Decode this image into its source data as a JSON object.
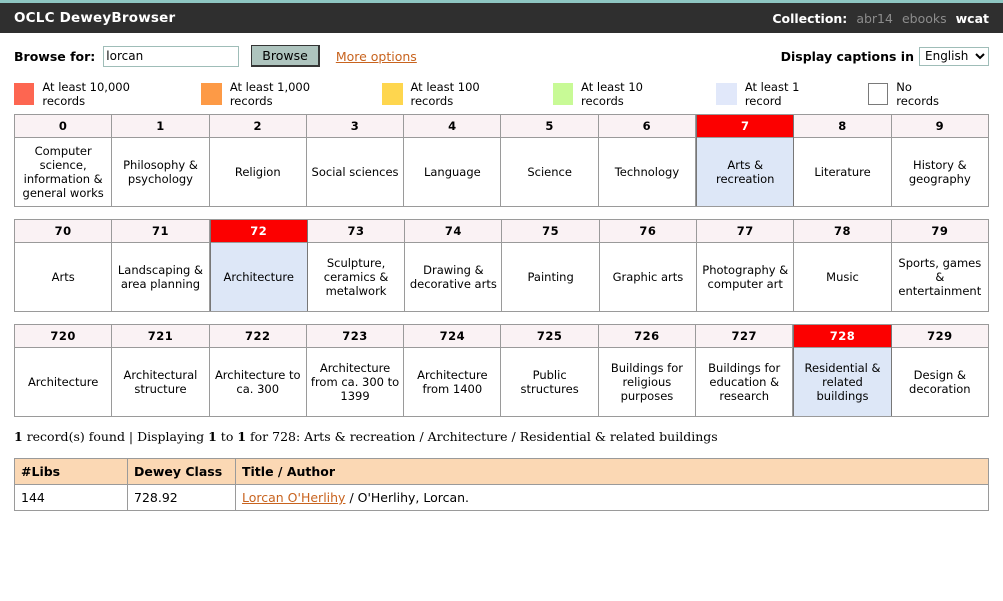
{
  "header": {
    "app_title": "OCLC DeweyBrowser",
    "collection_label": "Collection:",
    "collections": [
      {
        "name": "abr14",
        "active": false
      },
      {
        "name": "ebooks",
        "active": false
      },
      {
        "name": "wcat",
        "active": true
      }
    ]
  },
  "search": {
    "browse_for_label": "Browse for:",
    "query_value": "lorcan",
    "query_placeholder": "",
    "browse_button_label": "Browse",
    "more_options_label": "More options",
    "captions_label": "Display captions in",
    "language_value": "English",
    "language_options": [
      "English"
    ]
  },
  "legend": {
    "items": [
      {
        "label": "At least 10,000 records",
        "color": "#fd6651",
        "bordered": false
      },
      {
        "label": "At least 1,000 records",
        "color": "#fd9a46",
        "bordered": false
      },
      {
        "label": "At least 100 records",
        "color": "#fed64e",
        "bordered": false
      },
      {
        "label": "At least 10 records",
        "color": "#c8fa96",
        "bordered": false
      },
      {
        "label": "At least 1 record",
        "color": "#e1e8fa",
        "bordered": false
      },
      {
        "label": "No records",
        "color": "#ffffff",
        "bordered": true
      }
    ]
  },
  "colors": {
    "selected_header": "#fc0000",
    "selected_body": "#dde7f7",
    "cell_header": "#faf2f4",
    "link": "#c8631e",
    "table_header": "#fbd8b4",
    "topbar": "#2f2f2f",
    "accent": "#8ec6c2"
  },
  "grids": [
    {
      "name": "top-level-classes",
      "cells": [
        {
          "number": "0",
          "caption": "Computer science, information & general works",
          "selected": false
        },
        {
          "number": "1",
          "caption": "Philosophy & psychology",
          "selected": false
        },
        {
          "number": "2",
          "caption": "Religion",
          "selected": false
        },
        {
          "number": "3",
          "caption": "Social sciences",
          "selected": false
        },
        {
          "number": "4",
          "caption": "Language",
          "selected": false
        },
        {
          "number": "5",
          "caption": "Science",
          "selected": false
        },
        {
          "number": "6",
          "caption": "Technology",
          "selected": false
        },
        {
          "number": "7",
          "caption": "Arts & recreation",
          "selected": true
        },
        {
          "number": "8",
          "caption": "Literature",
          "selected": false
        },
        {
          "number": "9",
          "caption": "History & geography",
          "selected": false
        }
      ]
    },
    {
      "name": "division-classes",
      "cells": [
        {
          "number": "70",
          "caption": "Arts",
          "selected": false
        },
        {
          "number": "71",
          "caption": "Landscaping & area planning",
          "selected": false
        },
        {
          "number": "72",
          "caption": "Architecture",
          "selected": true
        },
        {
          "number": "73",
          "caption": "Sculpture, ceramics & metalwork",
          "selected": false
        },
        {
          "number": "74",
          "caption": "Drawing & decorative arts",
          "selected": false
        },
        {
          "number": "75",
          "caption": "Painting",
          "selected": false
        },
        {
          "number": "76",
          "caption": "Graphic arts",
          "selected": false
        },
        {
          "number": "77",
          "caption": "Photography & computer art",
          "selected": false
        },
        {
          "number": "78",
          "caption": "Music",
          "selected": false
        },
        {
          "number": "79",
          "caption": "Sports, games & entertainment",
          "selected": false
        }
      ]
    },
    {
      "name": "section-classes",
      "cells": [
        {
          "number": "720",
          "caption": "Architecture",
          "selected": false
        },
        {
          "number": "721",
          "caption": "Architectural structure",
          "selected": false
        },
        {
          "number": "722",
          "caption": "Architecture to ca. 300",
          "selected": false
        },
        {
          "number": "723",
          "caption": "Architecture from ca. 300 to 1399",
          "selected": false
        },
        {
          "number": "724",
          "caption": "Architecture from 1400",
          "selected": false
        },
        {
          "number": "725",
          "caption": "Public structures",
          "selected": false
        },
        {
          "number": "726",
          "caption": "Buildings for religious purposes",
          "selected": false
        },
        {
          "number": "727",
          "caption": "Buildings for education & research",
          "selected": false
        },
        {
          "number": "728",
          "caption": "Residential & related buildings",
          "selected": true
        },
        {
          "number": "729",
          "caption": "Design & decoration",
          "selected": false
        }
      ]
    }
  ],
  "status": {
    "record_count": "1",
    "found_text": "record(s) found | Displaying",
    "range_from": "1",
    "to_text": "to",
    "range_to": "1",
    "for_text": "for 728: Arts & recreation / Architecture / Residential & related buildings"
  },
  "results": {
    "columns": [
      "#Libs",
      "Dewey Class",
      "Title / Author"
    ],
    "rows": [
      {
        "libs": "144",
        "dewey": "728.92",
        "title": "Lorcan O'Herlihy",
        "author": " / O'Herlihy, Lorcan."
      }
    ]
  }
}
